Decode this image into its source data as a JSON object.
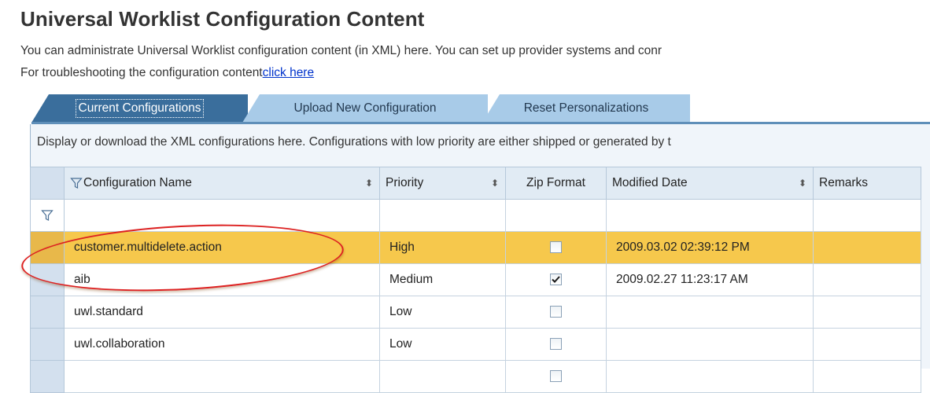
{
  "page": {
    "title": "Universal Worklist Configuration Content",
    "description_line1": "You can administrate Universal Worklist configuration content (in XML) here. You can set up provider systems and conr",
    "description_line2_prefix": "For troubleshooting the configuration content",
    "description_line2_link": "click here"
  },
  "tabs": {
    "current": "Current Configurations",
    "upload": "Upload New Configuration",
    "reset": "Reset Personalizations"
  },
  "panel": {
    "description": "Display or download the XML configurations here. Configurations with low priority are either shipped or generated by t"
  },
  "table": {
    "columns": {
      "name": "Configuration Name",
      "priority": "Priority",
      "zip": "Zip Format",
      "modified": "Modified Date",
      "remarks": "Remarks"
    },
    "rows": [
      {
        "name": "customer.multidelete.action",
        "priority": "High",
        "zip": false,
        "modified": "2009.03.02 02:39:12 PM",
        "remarks": "",
        "highlighted": true
      },
      {
        "name": "aib",
        "priority": "Medium",
        "zip": true,
        "modified": "2009.02.27 11:23:17 AM",
        "remarks": "",
        "highlighted": false
      },
      {
        "name": "uwl.standard",
        "priority": "Low",
        "zip": false,
        "modified": "",
        "remarks": "",
        "highlighted": false
      },
      {
        "name": "uwl.collaboration",
        "priority": "Low",
        "zip": false,
        "modified": "",
        "remarks": "",
        "highlighted": false
      }
    ]
  },
  "icons": {
    "filter": "filter-funnel-icon",
    "sort": "sort-arrows-icon",
    "check": "checkmark-icon"
  },
  "colors": {
    "tab_active": "#3a6e9c",
    "tab_inactive": "#a8cbe8",
    "highlight_row": "#f6c84c",
    "annotation": "#dd2222",
    "link": "#0033cc"
  }
}
